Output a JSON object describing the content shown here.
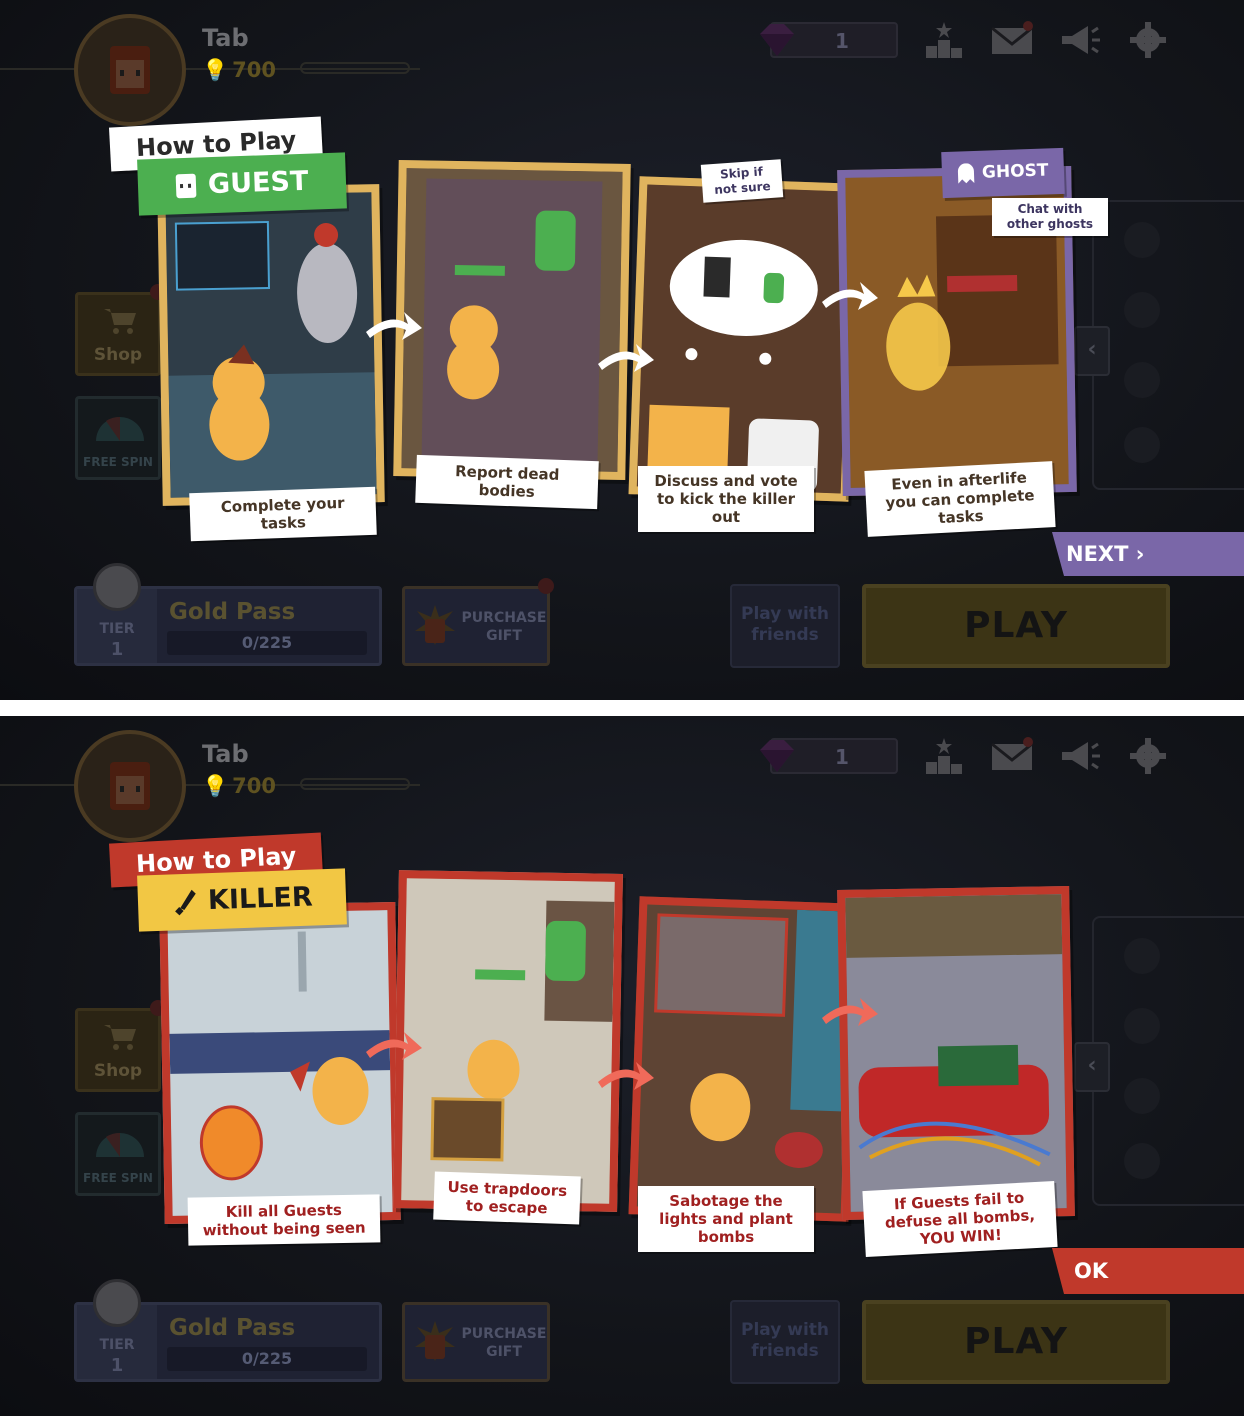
{
  "player": {
    "name": "Tab",
    "coins": "700"
  },
  "gems": {
    "count": "1"
  },
  "menu": {
    "shop_label": "Shop",
    "free_spin_label": "FREE SPIN"
  },
  "gold_pass": {
    "tier_label": "TIER",
    "tier_value": "1",
    "title": "Gold Pass",
    "progress": "0/225"
  },
  "purchase_gift": {
    "label": "PURCHASE GIFT"
  },
  "play_with_friends": {
    "label": "Play with friends"
  },
  "play": {
    "label": "PLAY"
  },
  "guest_tutorial": {
    "title": "How to Play",
    "role": "GUEST",
    "ghost_role": "GHOST",
    "cards": [
      {
        "caption": "Complete your tasks"
      },
      {
        "caption": "Report dead bodies"
      },
      {
        "caption": "Discuss and vote to kick the killer out",
        "note": "Skip if not sure"
      },
      {
        "caption": "Even in afterlife you can complete tasks",
        "note": "Chat with other ghosts"
      }
    ],
    "next_label": "NEXT",
    "colors": {
      "role": "#4caf50",
      "ghost": "#7a67a8",
      "card_border": "#e0b45e"
    }
  },
  "killer_tutorial": {
    "title": "How to Play",
    "role": "KILLER",
    "cards": [
      {
        "caption": "Kill all Guests without being seen"
      },
      {
        "caption": "Use trapdoors to escape"
      },
      {
        "caption": "Sabotage the lights and plant bombs"
      },
      {
        "caption": "If Guests fail to defuse all bombs, YOU WIN!"
      }
    ],
    "ok_label": "OK",
    "colors": {
      "role": "#f2c744",
      "title": "#c0392b",
      "card_border": "#c0392b"
    }
  },
  "icons": [
    "crown-icon",
    "gem-icon",
    "leaderboard-icon",
    "mail-icon",
    "megaphone-icon",
    "gear-icon",
    "cart-icon",
    "wheel-icon",
    "chevron-left-icon",
    "chevron-right-icon",
    "knife-icon",
    "ghost-icon",
    "marshmallow-icon"
  ]
}
